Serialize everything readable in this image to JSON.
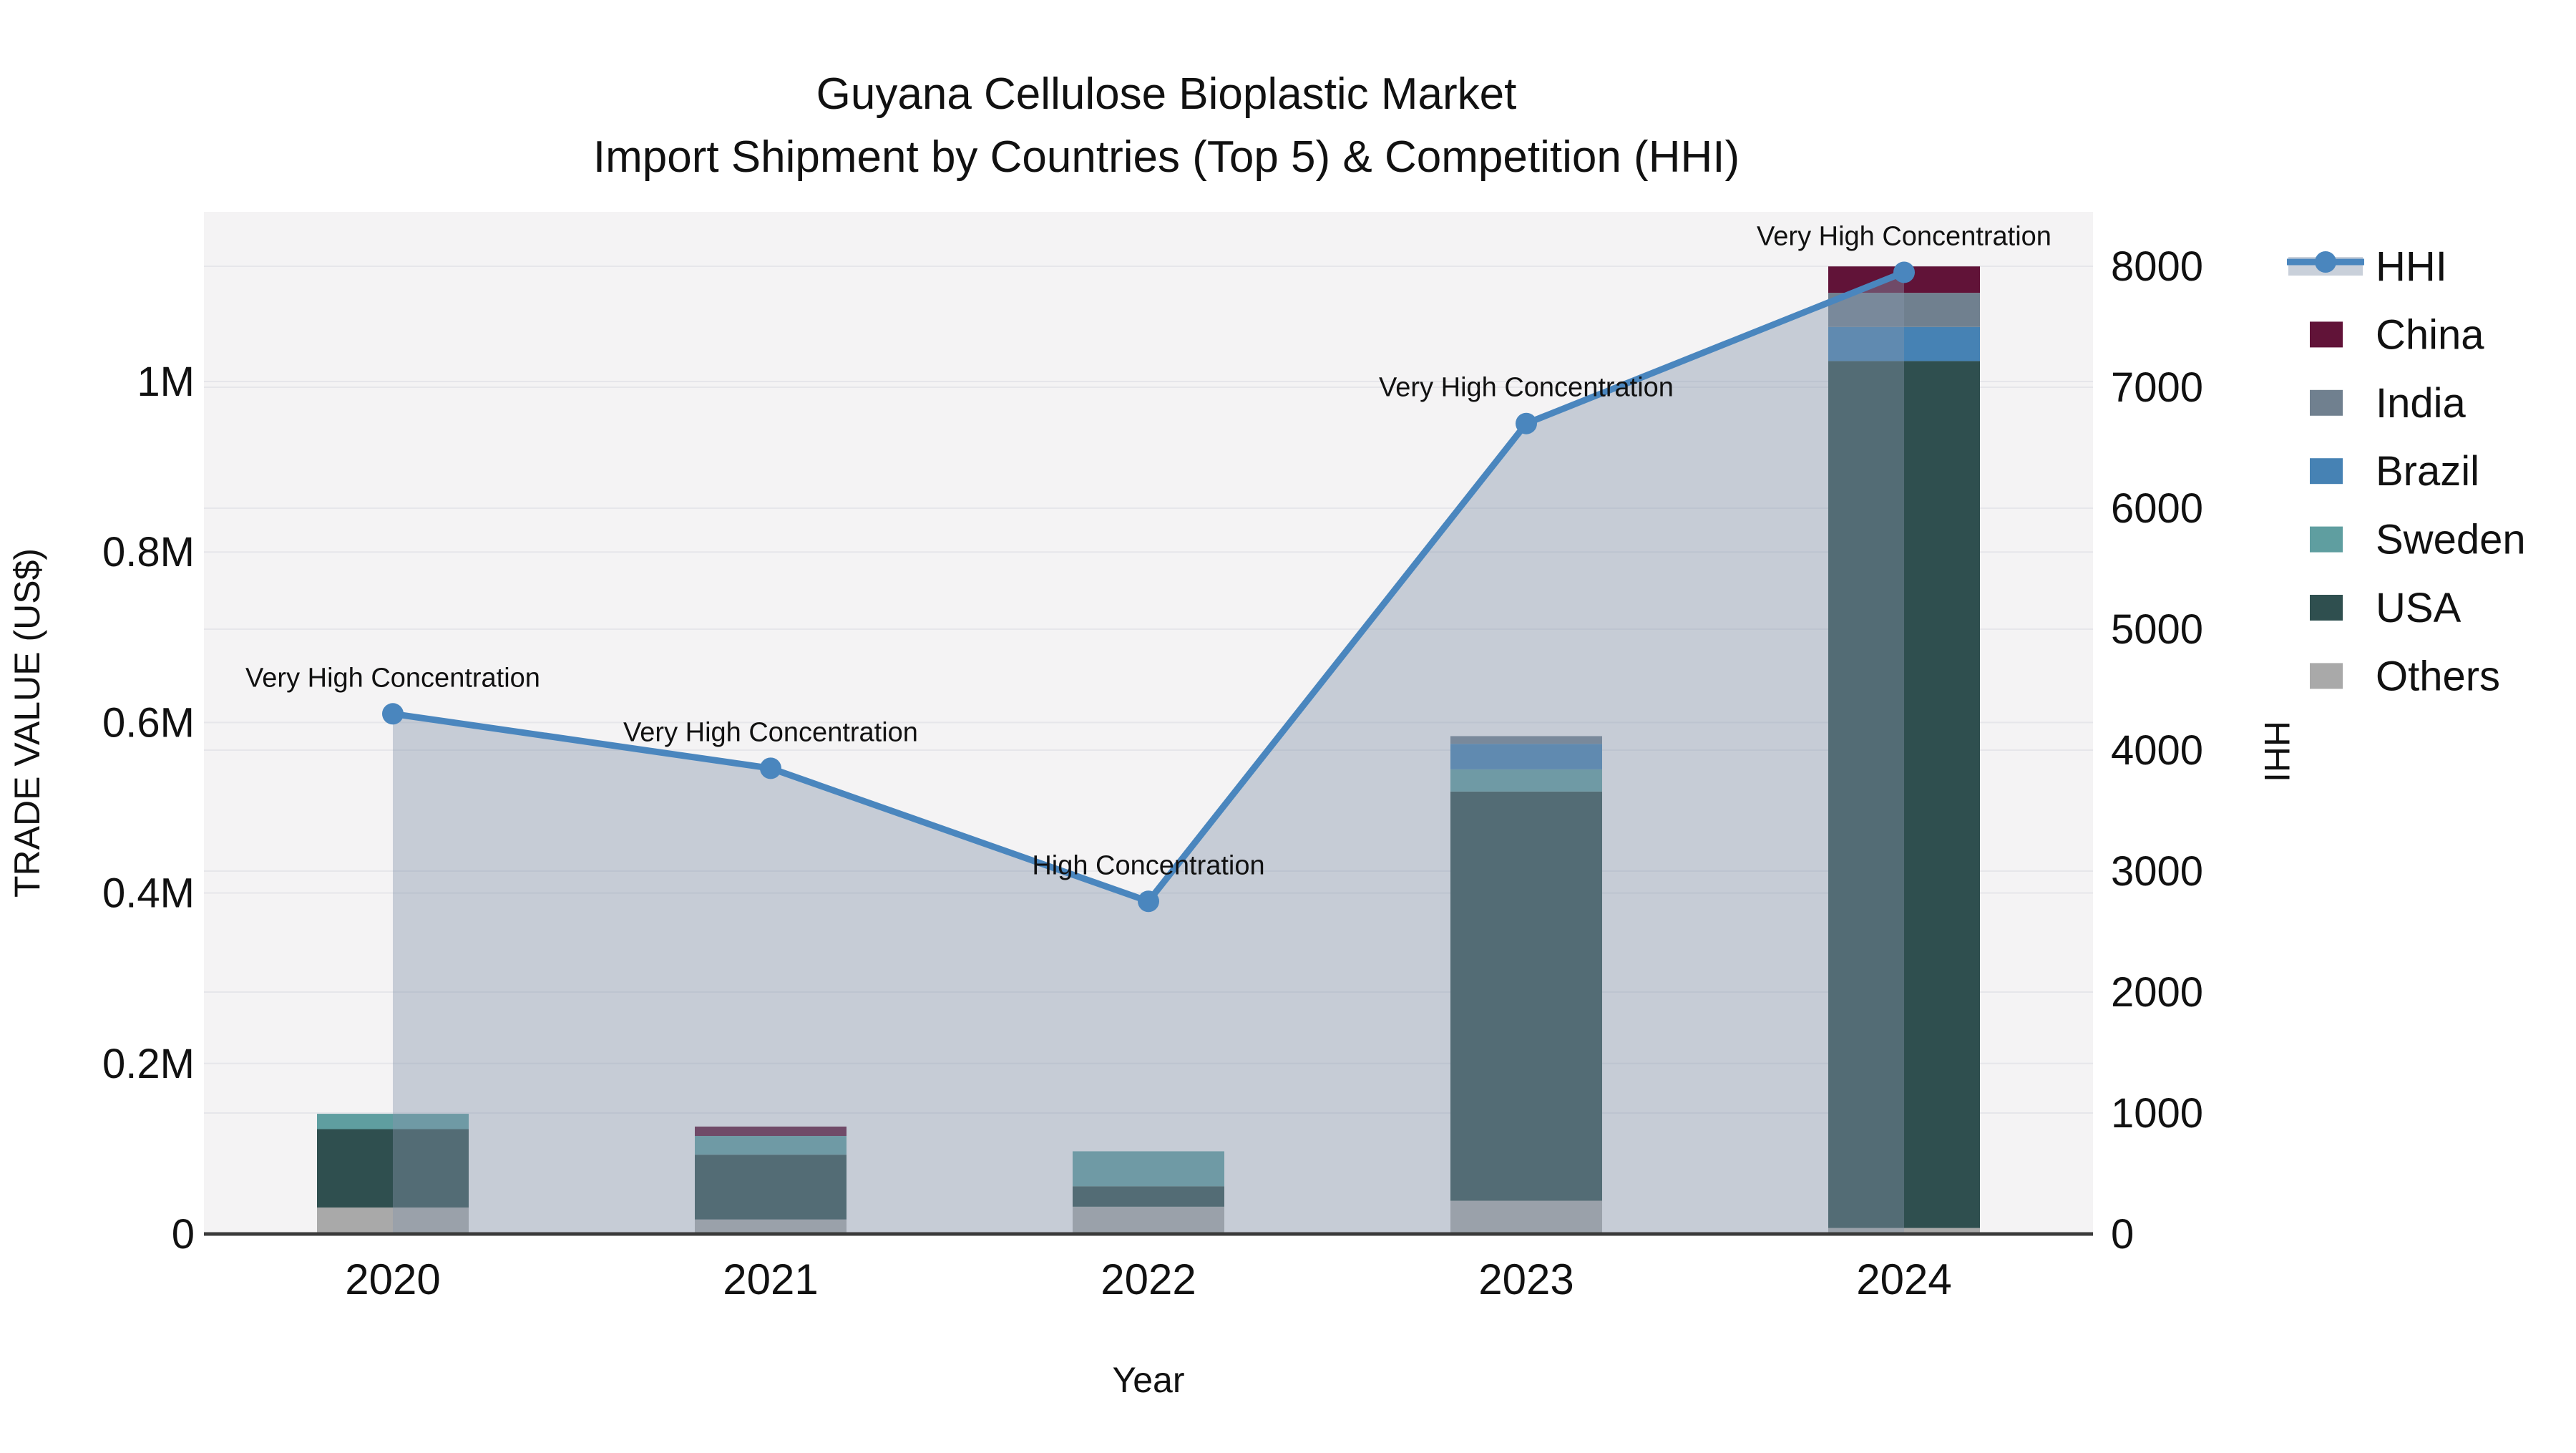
{
  "page": {
    "background": "#ffffff",
    "plot_background": "#f4f3f4",
    "gridline_color": "#e6e6ea",
    "axis_line_color": "#3a3a3a",
    "text_color": "#111111"
  },
  "chart_data": {
    "type": "bar+line",
    "title": "Guyana Cellulose Bioplastic Market",
    "subtitle": "Import Shipment by Countries (Top 5) & Competition (HHI)",
    "xlabel": "Year",
    "ylabel_left": "TRADE VALUE (US$)",
    "ylabel_right": "HHI",
    "categories": [
      "2020",
      "2021",
      "2022",
      "2023",
      "2024"
    ],
    "bar_series": [
      {
        "name": "China",
        "color": "#611338",
        "values": [
          0,
          11000,
          0,
          0,
          31000
        ]
      },
      {
        "name": "India",
        "color": "#70808f",
        "values": [
          0,
          0,
          0,
          9000,
          40000
        ]
      },
      {
        "name": "Brazil",
        "color": "#4682b4",
        "values": [
          0,
          0,
          0,
          30000,
          40000
        ]
      },
      {
        "name": "Sweden",
        "color": "#5f9ea0",
        "values": [
          18000,
          22000,
          41000,
          26000,
          0
        ]
      },
      {
        "name": "USA",
        "color": "#2f4f4f",
        "values": [
          92000,
          76000,
          24000,
          480000,
          1017000
        ]
      },
      {
        "name": "Others",
        "color": "#a9a9a9",
        "values": [
          31000,
          17000,
          32000,
          39000,
          7000
        ]
      }
    ],
    "stack_order_bottom_to_top": [
      "Others",
      "USA",
      "Sweden",
      "Brazil",
      "India",
      "China"
    ],
    "bar_totals": [
      141000,
      126000,
      97000,
      584000,
      1135000
    ],
    "hhi": {
      "name": "HHI",
      "line_color": "#4a86be",
      "area_color": "rgba(133,150,172,0.42)",
      "values": [
        4300,
        3850,
        2750,
        6700,
        7950
      ],
      "annotations": [
        "Very High Concentration",
        "Very High Concentration",
        "High Concentration",
        "Very High Concentration",
        "Very High Concentration"
      ]
    },
    "left_axis": {
      "ticks": [
        {
          "value": 0,
          "label": "0"
        },
        {
          "value": 200000,
          "label": "0.2M"
        },
        {
          "value": 400000,
          "label": "0.4M"
        },
        {
          "value": 600000,
          "label": "0.6M"
        },
        {
          "value": 800000,
          "label": "0.8M"
        },
        {
          "value": 1000000,
          "label": "1M"
        }
      ],
      "range": [
        0,
        1200000
      ]
    },
    "right_axis": {
      "ticks": [
        {
          "value": 0,
          "label": "0"
        },
        {
          "value": 1000,
          "label": "1000"
        },
        {
          "value": 2000,
          "label": "2000"
        },
        {
          "value": 3000,
          "label": "3000"
        },
        {
          "value": 4000,
          "label": "4000"
        },
        {
          "value": 5000,
          "label": "5000"
        },
        {
          "value": 6000,
          "label": "6000"
        },
        {
          "value": 7000,
          "label": "7000"
        },
        {
          "value": 8000,
          "label": "8000"
        }
      ],
      "range": [
        0,
        8450
      ]
    },
    "legend": [
      "HHI",
      "China",
      "India",
      "Brazil",
      "Sweden",
      "USA",
      "Others"
    ],
    "legend_position": "right"
  }
}
